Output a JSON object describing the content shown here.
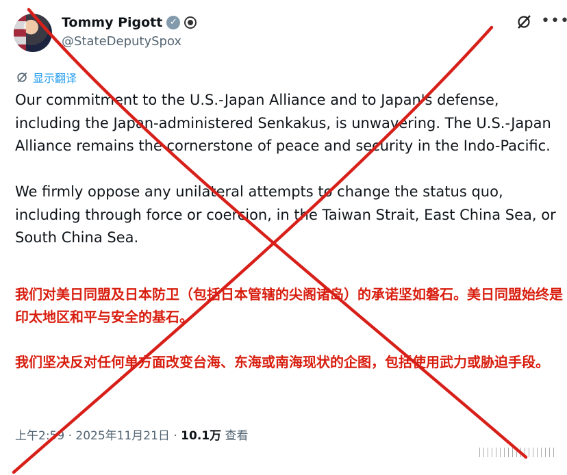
{
  "author": {
    "display_name": "Tommy Pigott",
    "handle": "@StateDeputySpox"
  },
  "translate": {
    "label": "显示翻译"
  },
  "tweet": {
    "en_paragraph_1": "Our commitment to the U.S.-Japan Alliance and to Japan's defense, including the Japan-administered Senkakus, is unwavering. The U.S.-Japan Alliance remains the cornerstone of peace and security in the Indo-Pacific.",
    "en_paragraph_2": "We firmly oppose any unilateral attempts to change the status quo, including through force or coercion, in the Taiwan Strait, East China Sea, or South China Sea.",
    "zh_paragraph_1": "我们对美日同盟及日本防卫（包括日本管辖的尖阁诸岛）的承诺坚如磐石。美日同盟始终是印太地区和平与安全的基石。",
    "zh_paragraph_2": "我们坚决反对任何单方面改变台海、东海或南海现状的企图，包括使用武力或胁迫手段。"
  },
  "meta": {
    "time": "上午2:59",
    "separator": " · ",
    "date": "2025年11月21日",
    "views_count": "10.1万",
    "views_label": " 查看"
  },
  "colors": {
    "cross": "#d8201a",
    "link": "#1d9bf0",
    "chinese_text": "#d81e0f"
  },
  "icons": [
    "verified-badge-icon",
    "government-badge-icon",
    "grok-icon",
    "more-icon",
    "translate-icon"
  ]
}
